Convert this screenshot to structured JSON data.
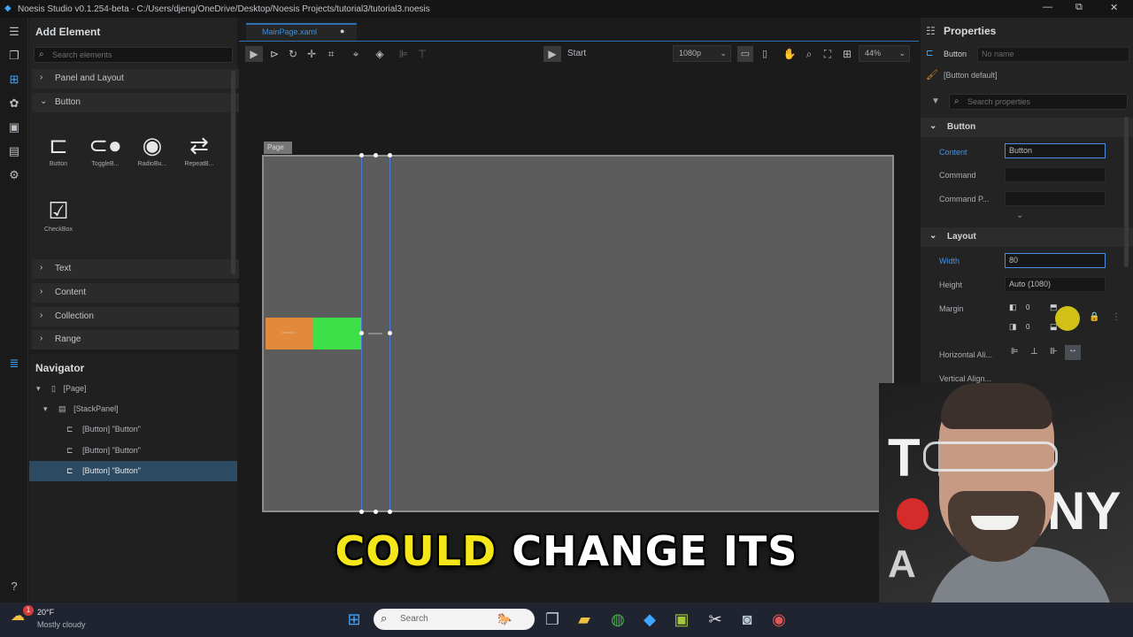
{
  "titlebar": {
    "title": "Noesis Studio v0.1.254-beta - C:/Users/djeng/OneDrive/Desktop/Noesis Projects/tutorial3/tutorial3.noesis",
    "minimize": "—",
    "maximize": "⧉",
    "close": "✕"
  },
  "add_element": {
    "title": "Add Element",
    "search_placeholder": "Search elements",
    "categories": [
      {
        "label": "Panel and Layout",
        "expanded": false
      },
      {
        "label": "Button",
        "expanded": true
      },
      {
        "label": "Text",
        "expanded": false
      },
      {
        "label": "Content",
        "expanded": false
      },
      {
        "label": "Collection",
        "expanded": false
      },
      {
        "label": "Range",
        "expanded": false
      }
    ],
    "tools": [
      {
        "label": "Button",
        "icon": "button-icon"
      },
      {
        "label": "ToggleB...",
        "icon": "toggle-icon"
      },
      {
        "label": "RadioBu...",
        "icon": "radio-icon"
      },
      {
        "label": "RepeatB...",
        "icon": "repeat-button-icon"
      },
      {
        "label": "CheckBox",
        "icon": "checkbox-icon"
      }
    ]
  },
  "navigator": {
    "title": "Navigator",
    "items": [
      {
        "label": "[Page]"
      },
      {
        "label": "[StackPanel]"
      },
      {
        "label": "[Button] \"Button\""
      },
      {
        "label": "[Button] \"Button\""
      },
      {
        "label": "[Button] \"Button\"",
        "selected": true
      }
    ]
  },
  "editor": {
    "tab_label": "MainPage.xaml",
    "start_label": "Start",
    "resolution": "1080p",
    "zoom": "44%",
    "page_tag": "Page"
  },
  "properties": {
    "title": "Properties",
    "type_label": "Button",
    "name_placeholder": "No name",
    "style_label": "[Button default]",
    "search_placeholder": "Search properties",
    "sections": {
      "button": "Button",
      "layout": "Layout"
    },
    "fields": {
      "content_label": "Content",
      "content_value": "Button",
      "command_label": "Command",
      "command_param_label": "Command P...",
      "width_label": "Width",
      "width_value": "80",
      "height_label": "Height",
      "height_value": "Auto (1080)",
      "margin_label": "Margin",
      "margin_values": [
        "0",
        "0",
        "0",
        "0"
      ],
      "halign_label": "Horizontal Ali...",
      "valign_label": "Vertical Align..."
    }
  },
  "caption": {
    "highlight": "COULD",
    "rest": "CHANGE ITS"
  },
  "webcam": {
    "sign_text_1": "T    ER",
    "sign_text_2": "NY",
    "sign_text_3": "A"
  },
  "taskbar": {
    "weather_temp": "20°F",
    "weather_desc": "Mostly cloudy",
    "notification_count": "1",
    "search_placeholder": "Search"
  },
  "colors": {
    "accent_blue": "#4a78d8",
    "orange_button": "#e08a3a",
    "green_button": "#3ee04a",
    "caption_yellow": "#f5e61a",
    "selected_row": "#2c4a62"
  }
}
